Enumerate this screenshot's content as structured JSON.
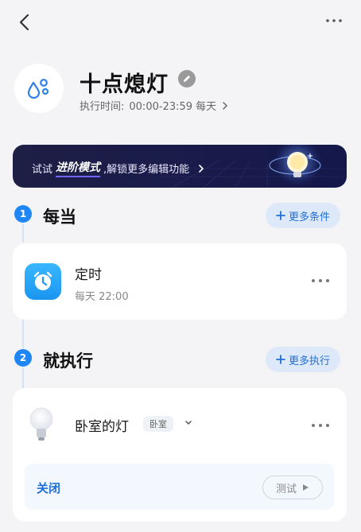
{
  "header": {
    "back_icon": "chevron-left-icon",
    "more_icon": "more-horizontal-icon"
  },
  "scene": {
    "icon": "water-drop-icon",
    "name": "十点熄灯",
    "time_label": "执行时间:",
    "time_range": "00:00-23:59 每天"
  },
  "banner": {
    "prefix": "试试",
    "highlight": "进阶模式",
    "suffix": ",解锁更多编辑功能"
  },
  "section_when": {
    "step": "1",
    "title": "每当",
    "add_button": "更多条件",
    "card": {
      "title": "定时",
      "subtitle": "每天 22:00"
    }
  },
  "section_then": {
    "step": "2",
    "title": "就执行",
    "add_button": "更多执行",
    "card": {
      "device": "卧室的灯",
      "room": "卧室",
      "action": "关闭",
      "test_button": "测试"
    }
  },
  "colors": {
    "accent": "#1f87f5",
    "background": "#f4f4f6",
    "banner": "#1d1f45"
  }
}
